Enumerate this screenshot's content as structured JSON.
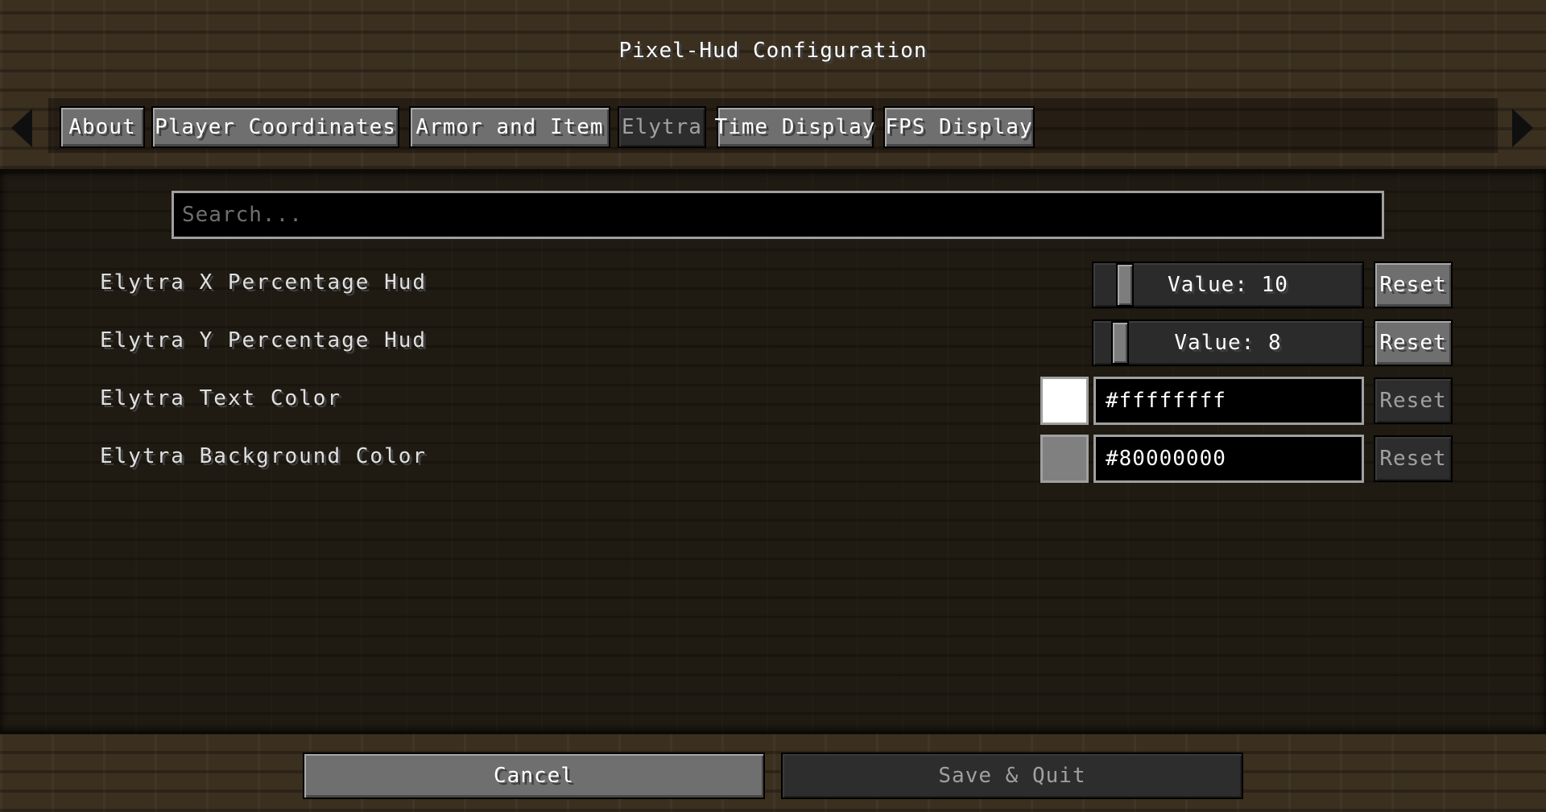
{
  "window": {
    "title": "Pixel-Hud Configuration"
  },
  "tabs": [
    {
      "label": "About",
      "active": false
    },
    {
      "label": "Player Coordinates",
      "active": false
    },
    {
      "label": "Armor and Item",
      "active": false
    },
    {
      "label": "Elytra",
      "active": true
    },
    {
      "label": "Time Display",
      "active": false
    },
    {
      "label": "FPS Display",
      "active": false
    }
  ],
  "nav": {
    "left_arrow_icon": "arrow-left-icon",
    "right_arrow_icon": "arrow-right-icon"
  },
  "search": {
    "placeholder": "Search..."
  },
  "options": [
    {
      "label": "Elytra X Percentage Hud",
      "type": "slider",
      "value_text": "Value: 10",
      "value": 10,
      "reset_label": "Reset",
      "reset_enabled": true
    },
    {
      "label": "Elytra Y Percentage Hud",
      "type": "slider",
      "value_text": "Value: 8",
      "value": 8,
      "reset_label": "Reset",
      "reset_enabled": true
    },
    {
      "label": "Elytra Text Color",
      "type": "color",
      "value_text": "#ffffffff",
      "swatch_color": "#ffffff",
      "reset_label": "Reset",
      "reset_enabled": false
    },
    {
      "label": "Elytra Background Color",
      "type": "color",
      "value_text": "#80000000",
      "swatch_color": "#808080",
      "reset_label": "Reset",
      "reset_enabled": false
    }
  ],
  "footer": {
    "cancel_label": "Cancel",
    "save_label": "Save & Quit",
    "save_enabled": false
  },
  "colors": {
    "button_gray": "#6f6f6f",
    "disabled_gray": "#2d2d2d",
    "field_border": "#a0a0a0"
  }
}
